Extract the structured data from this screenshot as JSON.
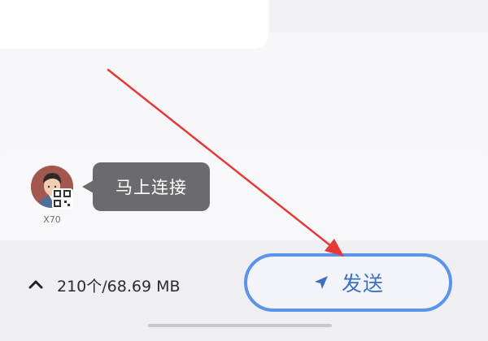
{
  "device": {
    "name": "X70",
    "avatar": "person-avatar-icon",
    "qr_icon": "qr-code-icon"
  },
  "tooltip": {
    "text": "马上连接"
  },
  "transfer": {
    "expand_icon": "chevron-up-icon",
    "summary": "210个/68.69 MB"
  },
  "send_button": {
    "label": "发送",
    "icon": "send-arrow-icon",
    "border_color": "#5b94ea",
    "text_color": "#3a6fc3"
  },
  "annotation": {
    "arrow_color": "#e53935",
    "icon": "annotation-arrow"
  }
}
